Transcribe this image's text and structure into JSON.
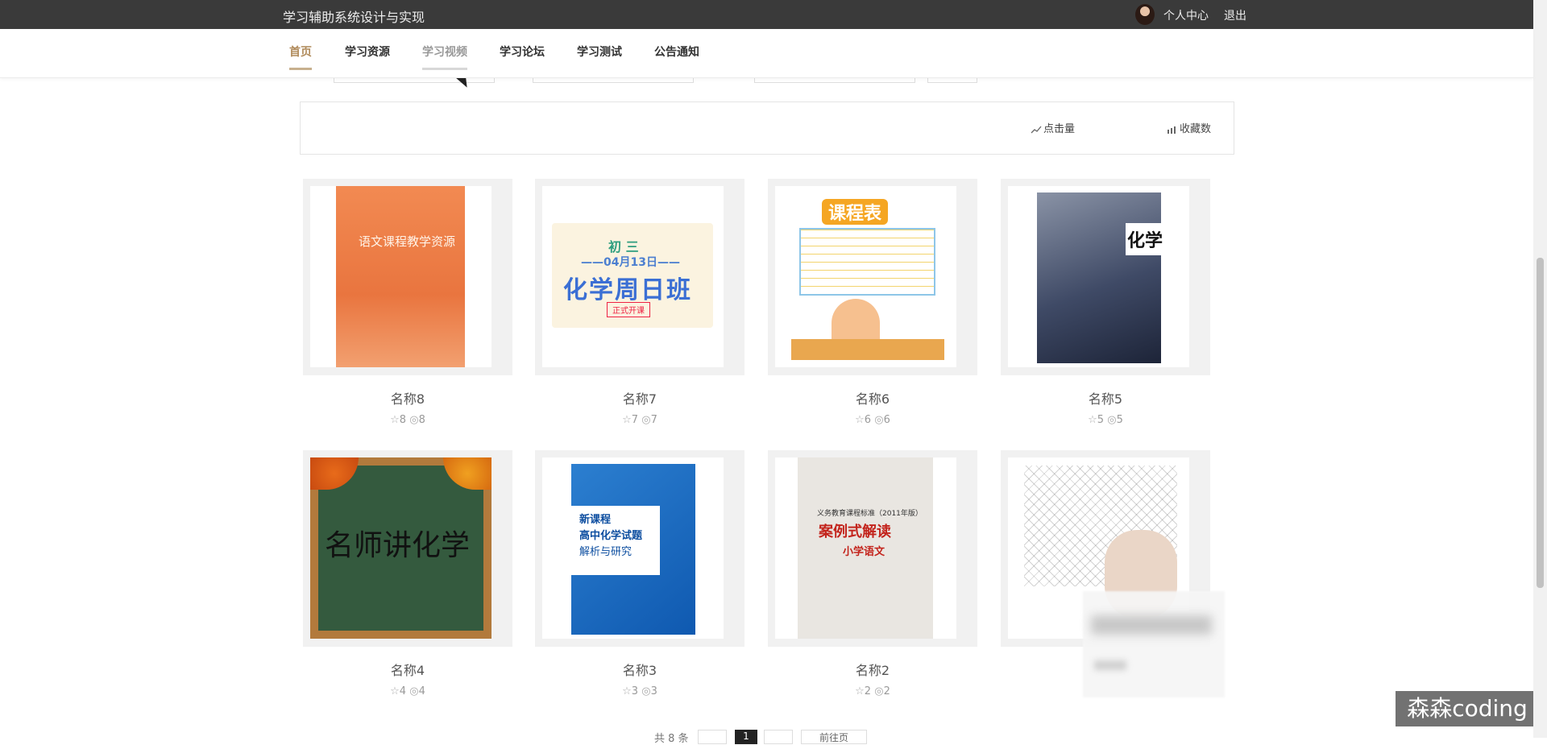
{
  "header": {
    "site_title": "学习辅助系统设计与实现",
    "user_center": "个人中心",
    "logout": "退出"
  },
  "nav": {
    "items": [
      {
        "label": "首页"
      },
      {
        "label": "学习资源"
      },
      {
        "label": "学习视频"
      },
      {
        "label": "学习论坛"
      },
      {
        "label": "学习测试"
      },
      {
        "label": "公告通知"
      }
    ]
  },
  "sort": {
    "clicks_label": "点击量",
    "favorites_label": "收藏数"
  },
  "items": [
    {
      "name": "名称8",
      "favorites": "8",
      "views": "8"
    },
    {
      "name": "名称7",
      "favorites": "7",
      "views": "7"
    },
    {
      "name": "名称6",
      "favorites": "6",
      "views": "6"
    },
    {
      "name": "名称5",
      "favorites": "5",
      "views": "5"
    },
    {
      "name": "名称4",
      "favorites": "4",
      "views": "4"
    },
    {
      "name": "名称3",
      "favorites": "3",
      "views": "3"
    },
    {
      "name": "名称2",
      "favorites": "2",
      "views": "2"
    }
  ],
  "thumbs": {
    "t1_title": "语文课程教学资源",
    "t2_line1": "初 三",
    "t2_line2": "——04月13日——",
    "t2_line3": "化学周日班",
    "t2_tag": "正式开课",
    "t3_header": "课程表",
    "t4_title": "化学",
    "t5_text": "名师讲化学",
    "t6_l1": "新课程",
    "t6_l2": "高中化学试题",
    "t6_l3": "解析与研究",
    "t7_l1": "义务教育课程标准（2011年版）",
    "t7_l2": "案例式解读",
    "t7_l3": "小学语文"
  },
  "pagination": {
    "total": "共 8 条",
    "current_page": "1",
    "goto": "前往页"
  },
  "watermark": "森森coding",
  "icons": {
    "star": "☆",
    "eye": "◎"
  },
  "colors": {
    "topbar": "#3a3a3a",
    "accent": "#b08a5a",
    "underline": "#c7b08e"
  }
}
